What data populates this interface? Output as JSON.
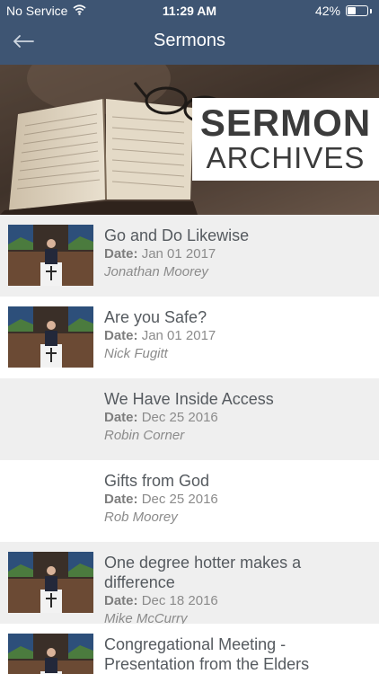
{
  "status": {
    "carrier": "No Service",
    "time": "11:29 AM",
    "battery": "42%",
    "battery_level": 0.42
  },
  "nav": {
    "title": "Sermons",
    "back_icon": "arrow-left-icon"
  },
  "banner": {
    "line1": "SERMON",
    "line2": "ARCHIVES"
  },
  "sermons": [
    {
      "title": "Go and Do Likewise",
      "date_label": "Date:",
      "date": "Jan 01 2017",
      "speaker": "Jonathan Moorey",
      "has_thumb": true
    },
    {
      "title": "Are you Safe?",
      "date_label": "Date:",
      "date": "Jan 01 2017",
      "speaker": "Nick Fugitt",
      "has_thumb": true
    },
    {
      "title": "We Have Inside Access",
      "date_label": "Date:",
      "date": "Dec 25 2016",
      "speaker": "Robin Corner",
      "has_thumb": false
    },
    {
      "title": "Gifts from God",
      "date_label": "Date:",
      "date": "Dec 25 2016",
      "speaker": "Rob Moorey",
      "has_thumb": false
    },
    {
      "title": "One degree hotter makes a difference",
      "date_label": "Date:",
      "date": "Dec 18 2016",
      "speaker": "Mike McCurry",
      "has_thumb": true
    },
    {
      "title": "Congregational Meeting - Presentation from the Elders",
      "date_label": "",
      "date": "",
      "speaker": "",
      "has_thumb": true
    }
  ]
}
